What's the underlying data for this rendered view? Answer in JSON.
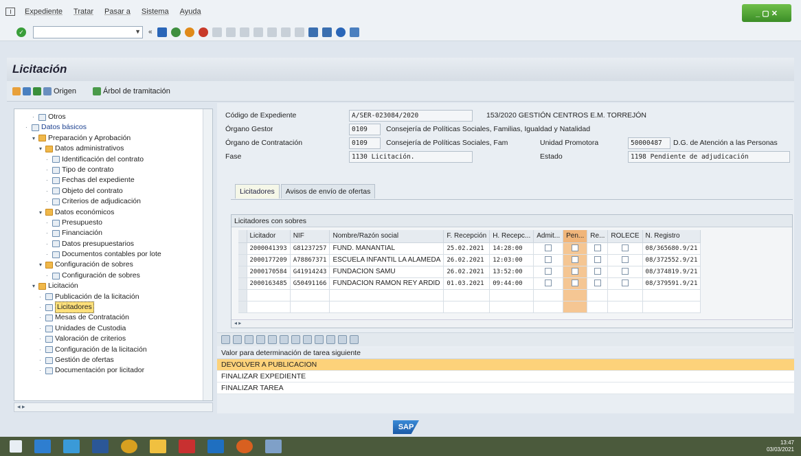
{
  "menu": [
    "Expediente",
    "Tratar",
    "Pasar a",
    "Sistema",
    "Ayuda"
  ],
  "window_controls": "_ ▢ ✕",
  "title": "Licitación",
  "app_toolbar": {
    "origen": "Origen",
    "arbol": "Árbol de tramitación"
  },
  "tree": [
    {
      "label": "Otros",
      "level": 1,
      "type": "doc"
    },
    {
      "label": "Datos básicos",
      "level": 0,
      "type": "doc",
      "highlight": true
    },
    {
      "label": "Preparación y Aprobación",
      "level": 1,
      "type": "folder"
    },
    {
      "label": "Datos administrativos",
      "level": 2,
      "type": "folder"
    },
    {
      "label": "Identificación del contrato",
      "level": 3,
      "type": "doc"
    },
    {
      "label": "Tipo de contrato",
      "level": 3,
      "type": "doc"
    },
    {
      "label": "Fechas del expediente",
      "level": 3,
      "type": "doc"
    },
    {
      "label": "Objeto del contrato",
      "level": 3,
      "type": "doc"
    },
    {
      "label": "Criterios de adjudicación",
      "level": 3,
      "type": "doc"
    },
    {
      "label": "Datos económicos",
      "level": 2,
      "type": "folder"
    },
    {
      "label": "Presupuesto",
      "level": 3,
      "type": "doc"
    },
    {
      "label": "Financiación",
      "level": 3,
      "type": "doc"
    },
    {
      "label": "Datos presupuestarios",
      "level": 3,
      "type": "doc"
    },
    {
      "label": "Documentos contables por lote",
      "level": 3,
      "type": "doc"
    },
    {
      "label": "Configuración de sobres",
      "level": 2,
      "type": "folder"
    },
    {
      "label": "Configuración de sobres",
      "level": 3,
      "type": "doc"
    },
    {
      "label": "Licitación",
      "level": 1,
      "type": "folder"
    },
    {
      "label": "Publicación de la licitación",
      "level": 2,
      "type": "doc"
    },
    {
      "label": "Licitadores",
      "level": 2,
      "type": "doc",
      "selected": true
    },
    {
      "label": "Mesas de Contratación",
      "level": 2,
      "type": "doc"
    },
    {
      "label": "Unidades de Custodia",
      "level": 2,
      "type": "doc"
    },
    {
      "label": "Valoración de criterios",
      "level": 2,
      "type": "doc"
    },
    {
      "label": "Configuración de la licitación",
      "level": 2,
      "type": "doc"
    },
    {
      "label": "Gestión de ofertas",
      "level": 2,
      "type": "doc"
    },
    {
      "label": "Documentación por licitador",
      "level": 2,
      "type": "doc"
    }
  ],
  "header": {
    "codigo_label": "Código de Expediente",
    "codigo_value": "A/SER-023084/2020",
    "codigo_desc": "153/2020 GESTIÓN CENTROS E.M. TORREJÓN",
    "organo_gestor_label": "Órgano Gestor",
    "organo_gestor_code": "0109",
    "organo_gestor_desc": "Consejería de Políticas Sociales, Familias, Igualdad y Natalidad",
    "organo_contr_label": "Órgano de Contratación",
    "organo_contr_code": "0109",
    "organo_contr_desc": "Consejería de Políticas Sociales, Fam",
    "unidad_label": "Unidad Promotora",
    "unidad_code": "50000487",
    "unidad_desc": "D.G. de Atención a las Personas",
    "fase_label": "Fase",
    "fase_value": "1130 Licitación.",
    "estado_label": "Estado",
    "estado_value": "1198 Pendiente de adjudicación"
  },
  "tabs": [
    "Licitadores",
    "Avisos de envío de ofertas"
  ],
  "grid": {
    "title": "Licitadores con sobres",
    "columns": [
      "Licitador",
      "NIF",
      "Nombre/Razón social",
      "F. Recepción",
      "H. Recepc...",
      "Admit...",
      "Pen...",
      "Re...",
      "ROLECE",
      "N. Registro"
    ],
    "rows": [
      [
        "2000041393",
        "G81237257",
        "FUND. MANANTIAL",
        "25.02.2021",
        "14:28:00",
        "08/365680.9/21"
      ],
      [
        "2000177209",
        "A78867371",
        "ESCUELA INFANTIL LA ALAMEDA",
        "26.02.2021",
        "12:03:00",
        "08/372552.9/21"
      ],
      [
        "2000170584",
        "G41914243",
        "FUNDACION SAMU",
        "26.02.2021",
        "13:52:00",
        "08/374819.9/21"
      ],
      [
        "2000163485",
        "G50491166",
        "FUNDACION RAMON REY ARDID",
        "01.03.2021",
        "09:44:00",
        "08/379591.9/21"
      ]
    ]
  },
  "next_task": {
    "header": "Valor para determinación de tarea siguiente",
    "options": [
      "DEVOLVER A PUBLICACION",
      "FINALIZAR EXPEDIENTE",
      "FINALIZAR TAREA"
    ],
    "selected_index": 0
  },
  "sap_logo": "SAP",
  "clock": {
    "time": "13:47",
    "date": "03/03/2021"
  }
}
